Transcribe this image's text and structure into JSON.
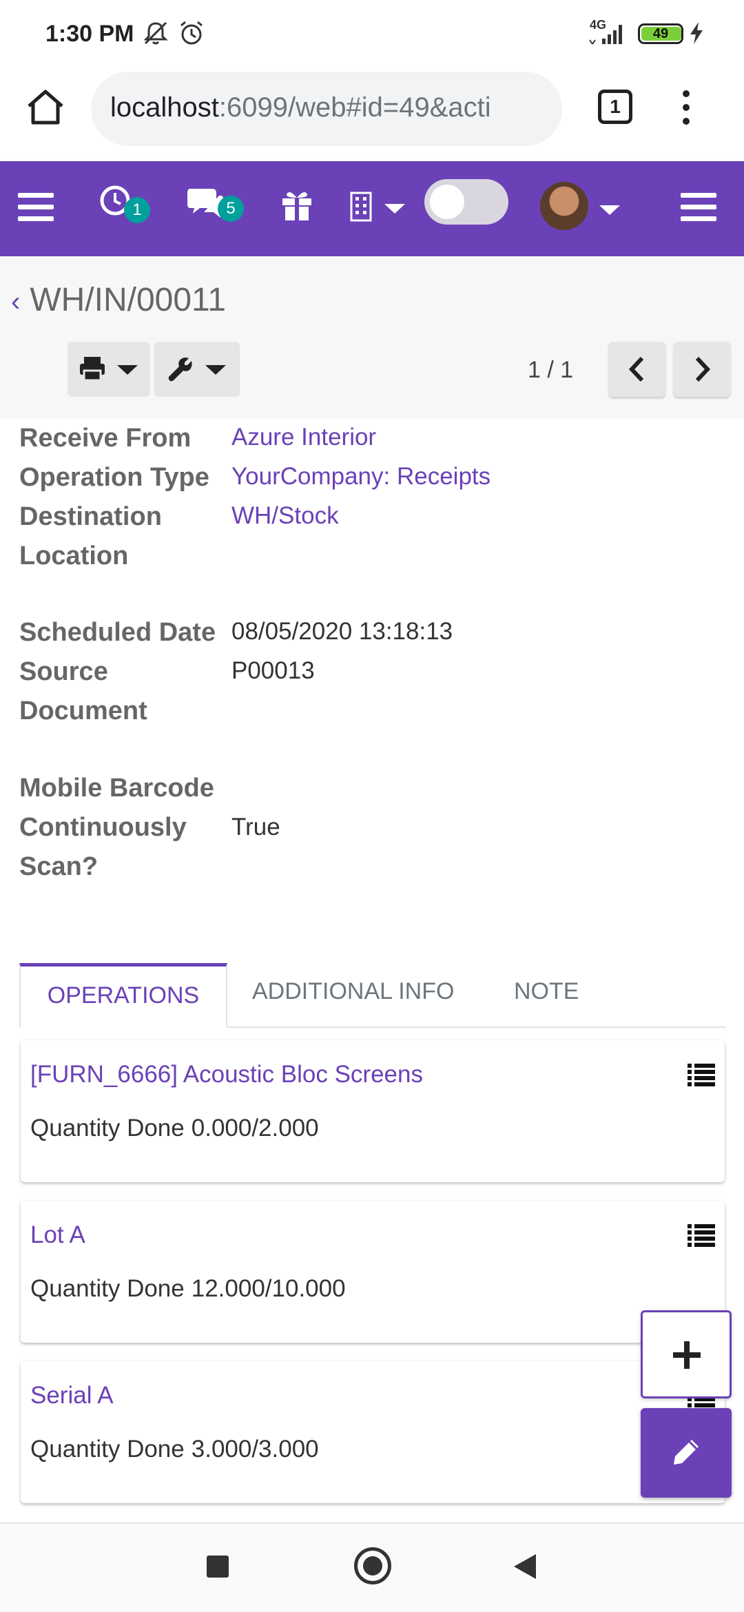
{
  "status_bar": {
    "time": "1:30 PM",
    "network": "4G",
    "battery": "49"
  },
  "browser": {
    "url_host": "localhost",
    "url_rest": ":6099/web#id=49&acti",
    "tab_count": "1"
  },
  "nav": {
    "activity_count": "1",
    "message_count": "5"
  },
  "control_panel": {
    "breadcrumb": "WH/IN/00011",
    "pager": "1 / 1"
  },
  "form": {
    "receive_from_label": "Receive From",
    "receive_from_value": "Azure Interior",
    "operation_type_label": "Operation Type",
    "operation_type_value": "YourCompany: Receipts",
    "destination_label_1": "Destination",
    "destination_label_2": "Location",
    "destination_value": "WH/Stock",
    "scheduled_date_label": "Scheduled Date",
    "scheduled_date_value": "08/05/2020 13:18:13",
    "source_label_1": "Source",
    "source_label_2": "Document",
    "source_value": "P00013",
    "barcode_label_1": "Mobile Barcode",
    "barcode_label_2": "Continuously",
    "barcode_label_3": "Scan?",
    "barcode_value": "True"
  },
  "tabs": [
    "OPERATIONS",
    "ADDITIONAL INFO",
    "NOTE"
  ],
  "operations": [
    {
      "title": "[FURN_6666] Acoustic Bloc Screens",
      "qty_label": "Quantity Done",
      "qty": "0.000/2.000"
    },
    {
      "title": "Lot A",
      "qty_label": "Quantity Done",
      "qty": "12.000/10.000"
    },
    {
      "title": "Serial A",
      "qty_label": "Quantity Done",
      "qty": "3.000/3.000"
    }
  ],
  "colors": {
    "brand": "#6a41b7",
    "badge": "#00a09d"
  },
  "icons": [
    "bell-mute-icon",
    "alarm-icon",
    "signal-icon",
    "battery-icon",
    "charging-icon",
    "home-icon",
    "tabs-icon",
    "more-vert-icon",
    "menu-icon",
    "clock-icon",
    "chat-icon",
    "gift-icon",
    "building-icon",
    "print-icon",
    "wrench-icon",
    "list-icon",
    "plus-icon",
    "pencil-icon"
  ]
}
